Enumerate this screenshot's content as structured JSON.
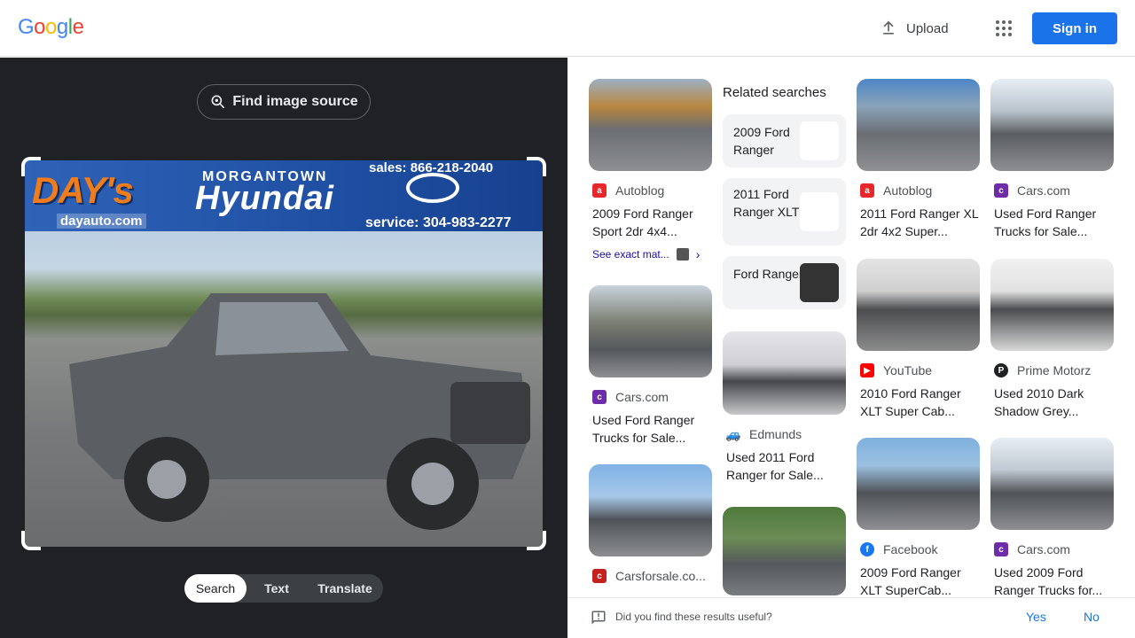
{
  "header": {
    "logo": "Google",
    "upload_label": "Upload",
    "signin_label": "Sign in"
  },
  "lens": {
    "find_source_label": "Find image source",
    "modes": [
      "Search",
      "Text",
      "Translate"
    ],
    "active_mode": "Search",
    "photo_text": {
      "dealer": "DAY's",
      "city": "MORGANTOWN",
      "brand": "Hyundai",
      "sales": "sales: 866-218-2040",
      "service": "service: 304-983-2277",
      "website": "dayauto.com"
    }
  },
  "results": {
    "col1": [
      {
        "source": "Autoblog",
        "title": "2009 Ford Ranger Sport 2dr 4x4...",
        "exact_label": "See exact mat..."
      },
      {
        "source": "Cars.com",
        "title": "Used Ford Ranger Trucks for Sale..."
      },
      {
        "source": "Carsforsale.co...",
        "title": ""
      }
    ],
    "related_title": "Related searches",
    "related": [
      "2009 Ford Ranger",
      "2011 Ford Ranger XLT",
      "Ford Ranger"
    ],
    "col2": [
      {
        "source": "Edmunds",
        "title": "Used 2011 Ford Ranger for Sale..."
      }
    ],
    "col3": [
      {
        "source": "Autoblog",
        "title": "2011 Ford Ranger XL 2dr 4x2 Super..."
      },
      {
        "source": "YouTube",
        "title": "2010 Ford Ranger XLT Super Cab..."
      },
      {
        "source": "Facebook",
        "title": "2009 Ford Ranger XLT SuperCab..."
      }
    ],
    "col4": [
      {
        "source": "Cars.com",
        "title": "Used Ford Ranger Trucks for Sale..."
      },
      {
        "source": "Prime Motorz",
        "title": "Used 2010 Dark Shadow Grey..."
      },
      {
        "source": "Cars.com",
        "title": "Used 2009 Ford Ranger Trucks for..."
      }
    ]
  },
  "feedback": {
    "question": "Did you find these results useful?",
    "yes": "Yes",
    "no": "No"
  },
  "colors": {
    "accent": "#1a73e8",
    "dark_bg": "#202124"
  }
}
